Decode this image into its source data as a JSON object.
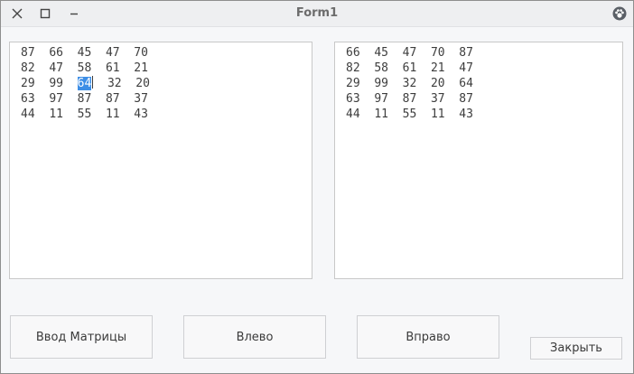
{
  "window": {
    "title": "Form1",
    "close_icon": "close-icon",
    "maximize_icon": "maximize-icon",
    "minimize_icon": "minimize-icon",
    "app_icon": "paw-icon"
  },
  "left_box": {
    "rows": [
      [
        "87",
        "66",
        "45",
        "47",
        "70"
      ],
      [
        "82",
        "47",
        "58",
        "61",
        "21"
      ],
      [
        "29",
        "99",
        "64",
        "32",
        "20"
      ],
      [
        "63",
        "97",
        "87",
        "87",
        "37"
      ],
      [
        "44",
        "11",
        "55",
        "11",
        "43"
      ]
    ],
    "selected": {
      "row": 2,
      "col": 2
    }
  },
  "right_box": {
    "rows": [
      [
        "66",
        "45",
        "47",
        "70",
        "87"
      ],
      [
        "82",
        "58",
        "61",
        "21",
        "47"
      ],
      [
        "29",
        "99",
        "32",
        "20",
        "64"
      ],
      [
        "63",
        "97",
        "87",
        "37",
        "87"
      ],
      [
        "44",
        "11",
        "55",
        "11",
        "43"
      ]
    ]
  },
  "buttons": {
    "input_matrix": "Ввод Матрицы",
    "left": "Влево",
    "right": "Вправо",
    "close": "Закрыть"
  }
}
